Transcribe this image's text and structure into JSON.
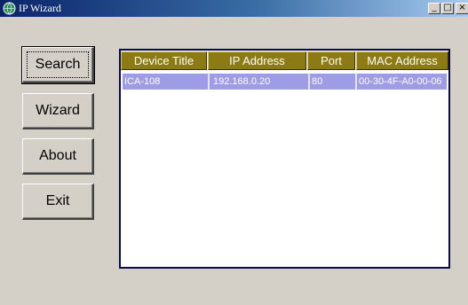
{
  "window": {
    "title": "IP Wizard",
    "controls": {
      "minimize": "_",
      "maximize": "□",
      "close": "×"
    }
  },
  "buttons": {
    "search": "Search",
    "wizard": "Wizard",
    "about": "About",
    "exit": "Exit"
  },
  "device_list": {
    "columns": [
      "Device Title",
      "IP Address",
      "Port",
      "MAC Address"
    ],
    "rows": [
      {
        "device_title": "ICA-108",
        "ip_address": "192.168.0.20",
        "port": "80",
        "mac_address": "00-30-4F-A0-00-06"
      }
    ]
  },
  "colors": {
    "header_bg": "#8c7a14",
    "selection": "#9e9ce6",
    "titlebar": "#0a246a",
    "face": "#d4d0c8"
  }
}
